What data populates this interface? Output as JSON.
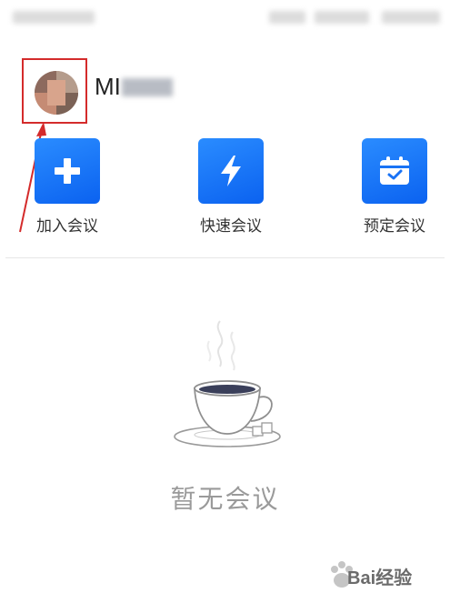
{
  "user": {
    "name_visible": "MI"
  },
  "actions": [
    {
      "label": "加入会议",
      "icon": "plus-icon"
    },
    {
      "label": "快速会议",
      "icon": "lightning-icon"
    },
    {
      "label": "预定会议",
      "icon": "calendar-check-icon"
    }
  ],
  "empty_state": {
    "text": "暂无会议",
    "icon": "coffee-cup-icon"
  },
  "watermark": {
    "text": "Bai经验"
  },
  "colors": {
    "accent": "#1a73f5",
    "annotation": "#d42b2b",
    "empty_text": "#9a9a9a"
  }
}
